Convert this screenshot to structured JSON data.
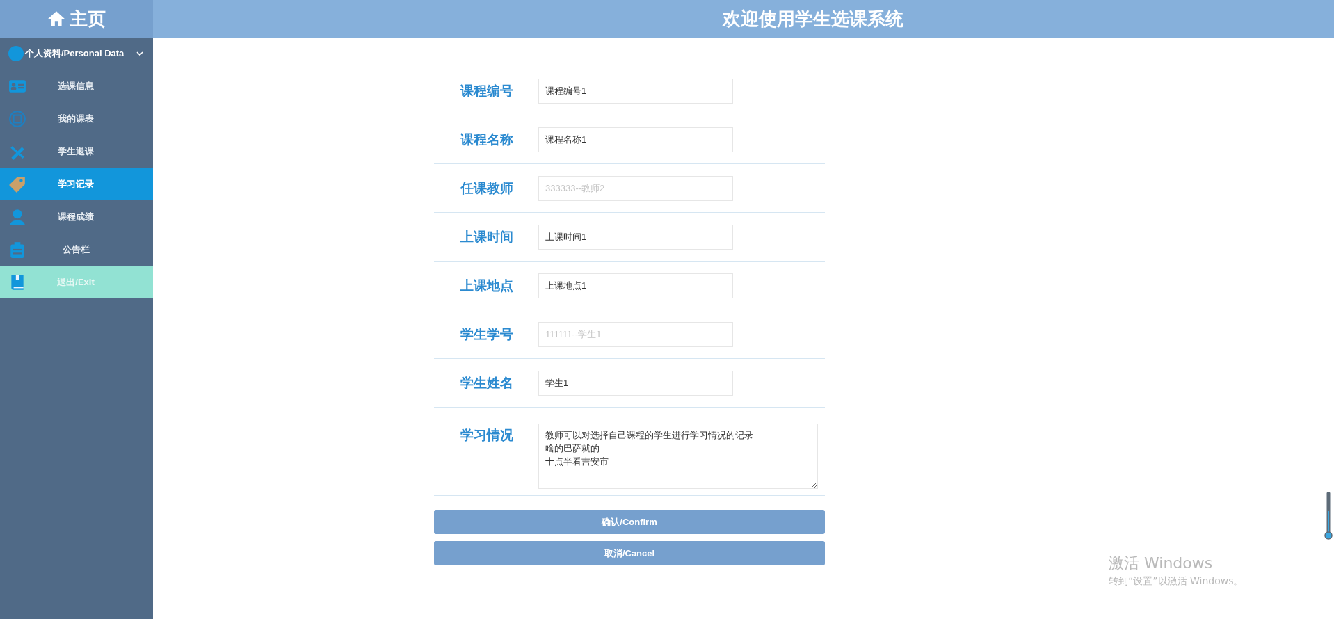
{
  "sidebar": {
    "home": "主页",
    "group": {
      "label": "个人资料/Personal Data",
      "expanded": true
    },
    "items": [
      {
        "label": "选课信息",
        "kind": "link",
        "selected": false
      },
      {
        "label": "我的课表",
        "kind": "link",
        "selected": false
      },
      {
        "label": "学生退课",
        "kind": "link",
        "selected": false
      },
      {
        "label": "学习记录",
        "kind": "link",
        "selected": true
      },
      {
        "label": "课程成绩",
        "kind": "link",
        "selected": false
      },
      {
        "label": "公告栏",
        "kind": "link",
        "selected": false
      },
      {
        "label": "退出/Exit",
        "kind": "exit",
        "selected": false
      }
    ]
  },
  "header": {
    "title": "欢迎使用学生选课系统"
  },
  "form": {
    "fields": [
      {
        "label": "课程编号",
        "kind": "input",
        "value": "课程编号1"
      },
      {
        "label": "课程名称",
        "kind": "input",
        "value": "课程名称1"
      },
      {
        "label": "任课教师",
        "kind": "input",
        "placeholder": "333333--教师2"
      },
      {
        "label": "上课时间",
        "kind": "input",
        "value": "上课时间1"
      },
      {
        "label": "上课地点",
        "kind": "input",
        "value": "上课地点1"
      },
      {
        "label": "学生学号",
        "kind": "input",
        "placeholder": "111111--学生1"
      },
      {
        "label": "学生姓名",
        "kind": "input",
        "value": "学生1"
      },
      {
        "label": "学习情况",
        "kind": "textarea",
        "lines": [
          "教师可以对选择自己课程的学生进行学习情况的记录",
          "啥的巴萨就的",
          "十点半看吉安市"
        ]
      }
    ],
    "buttons": [
      "确认/Confirm",
      "取消/Cancel"
    ]
  },
  "os_notice": {
    "title": "激活 Windows",
    "text": "转到“设置”以激活 Windows。"
  }
}
